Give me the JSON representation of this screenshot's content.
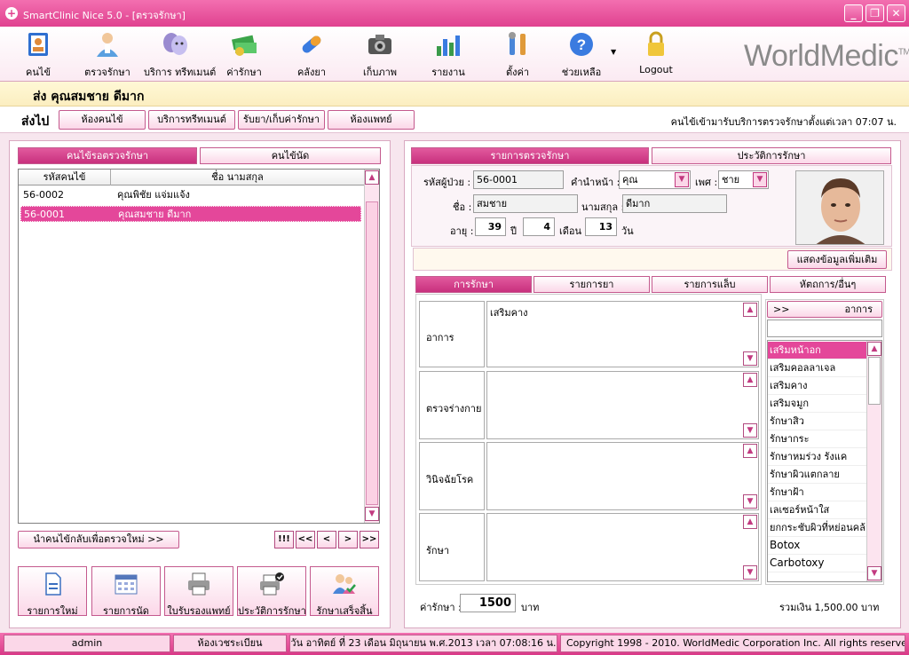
{
  "window": {
    "title": "SmartClinic Nice 5.0 - [ตรวจรักษา]"
  },
  "toolbar": {
    "items": [
      {
        "label": "คนไข้"
      },
      {
        "label": "ตรวจรักษา"
      },
      {
        "label": "บริการ ทรีทเมนต์"
      },
      {
        "label": "ค่ารักษา"
      },
      {
        "label": "คลังยา"
      },
      {
        "label": "เก็บภาพ"
      },
      {
        "label": "รายงาน"
      },
      {
        "label": "ตั้งค่า"
      },
      {
        "label": "ช่วยเหลือ"
      },
      {
        "label": "Logout"
      }
    ],
    "brand": "WorldMedic",
    "brand_tm": "TM"
  },
  "patient": {
    "header": "ส่ง  คุณสมชาย ดีมาก"
  },
  "sendbar": {
    "label": "ส่งไป",
    "buttons": [
      "ห้องคนไข้",
      "บริการทรีทเมนต์",
      "รับยา/เก็บค่ารักษา",
      "ห้องแพทย์"
    ],
    "info": "คนไข้เข้ามารับบริการตรวจรักษาตั้งแต่เวลา  07:07 น."
  },
  "left": {
    "tabs": [
      "คนไข้รอตรวจรักษา",
      "คนไข้นัด"
    ],
    "columns": [
      "รหัสคนไข้",
      "ชื่อ นามสกุล"
    ],
    "rows": [
      {
        "id": "56-0002",
        "name": "คุณพิชัย แจ่มแจ้ง"
      },
      {
        "id": "56-0001",
        "name": "คุณสมชาย ดีมาก"
      }
    ],
    "return_button": "นำคนไข้กลับเพื่อตรวจใหม่ >>",
    "nav": [
      "!!!",
      "<<",
      "<",
      ">",
      ">>"
    ],
    "actions": [
      "รายการใหม่",
      "รายการนัด",
      "ใบรับรองแพทย์",
      "ประวัติการรักษา",
      "รักษาเสร็จสิ้น"
    ]
  },
  "right": {
    "tabs": [
      "รายการตรวจรักษา",
      "ประวัติการรักษา"
    ],
    "labels": {
      "patient_id": "รหัสผู้ป่วย :",
      "prefix": "คำนำหน้า :",
      "gender": "เพศ :",
      "first_name": "ชื่อ :",
      "last_name": "นามสกุล :",
      "age": "อายุ :",
      "years": "ปี",
      "months": "เดือน",
      "days": "วัน"
    },
    "values": {
      "patient_id": "56-0001",
      "prefix": "คุณ",
      "gender": "ชาย",
      "first_name": "สมชาย",
      "last_name": "ดีมาก",
      "age_years": "39",
      "age_months": "4",
      "age_days": "13"
    },
    "more_button": "แสดงข้อมูลเพิ่มเติม",
    "subtabs": [
      "การรักษา",
      "รายการยา",
      "รายการแล็บ",
      "หัตถการ/อื่นๆ"
    ],
    "rows": [
      {
        "label": "อาการ",
        "text": "เสริมคาง"
      },
      {
        "label": "ตรวจร่างกาย",
        "text": ""
      },
      {
        "label": "วินิจฉัยโรค",
        "text": ""
      },
      {
        "label": "รักษา",
        "text": ""
      }
    ],
    "symptom_header_left": ">>",
    "symptom_header": "อาการ",
    "symptom_search": "",
    "symptoms": [
      "เสริมหน้าอก",
      "เสริมคอลลาเจล",
      "เสริมคาง",
      "เสริมจมูก",
      "รักษาสิว",
      "รักษากระ",
      "รักษาหมร่วง รังแค",
      "รักษาผิวแตกลาย",
      "รักษาฝ้า",
      "เลเซอร์หน้าใส",
      "ยกกระชับผิวที่หย่อนคล้อ",
      "Botox",
      "Carbotoxy"
    ],
    "fee_label": "ค่ารักษา :",
    "fee_value": "1500",
    "fee_unit": "บาท",
    "total": "รวมเงิน 1,500.00 บาท"
  },
  "status": {
    "user": "admin",
    "room": "ห้องเวชระเบียน",
    "datetime": "วัน อาทิตย์ ที่ 23 เดือน มิถุนายน พ.ศ.2013 เวลา 07:08:16 น.",
    "copyright": "Copyright 1998 - 2010. WorldMedic Corporation Inc. All rights reserve"
  }
}
